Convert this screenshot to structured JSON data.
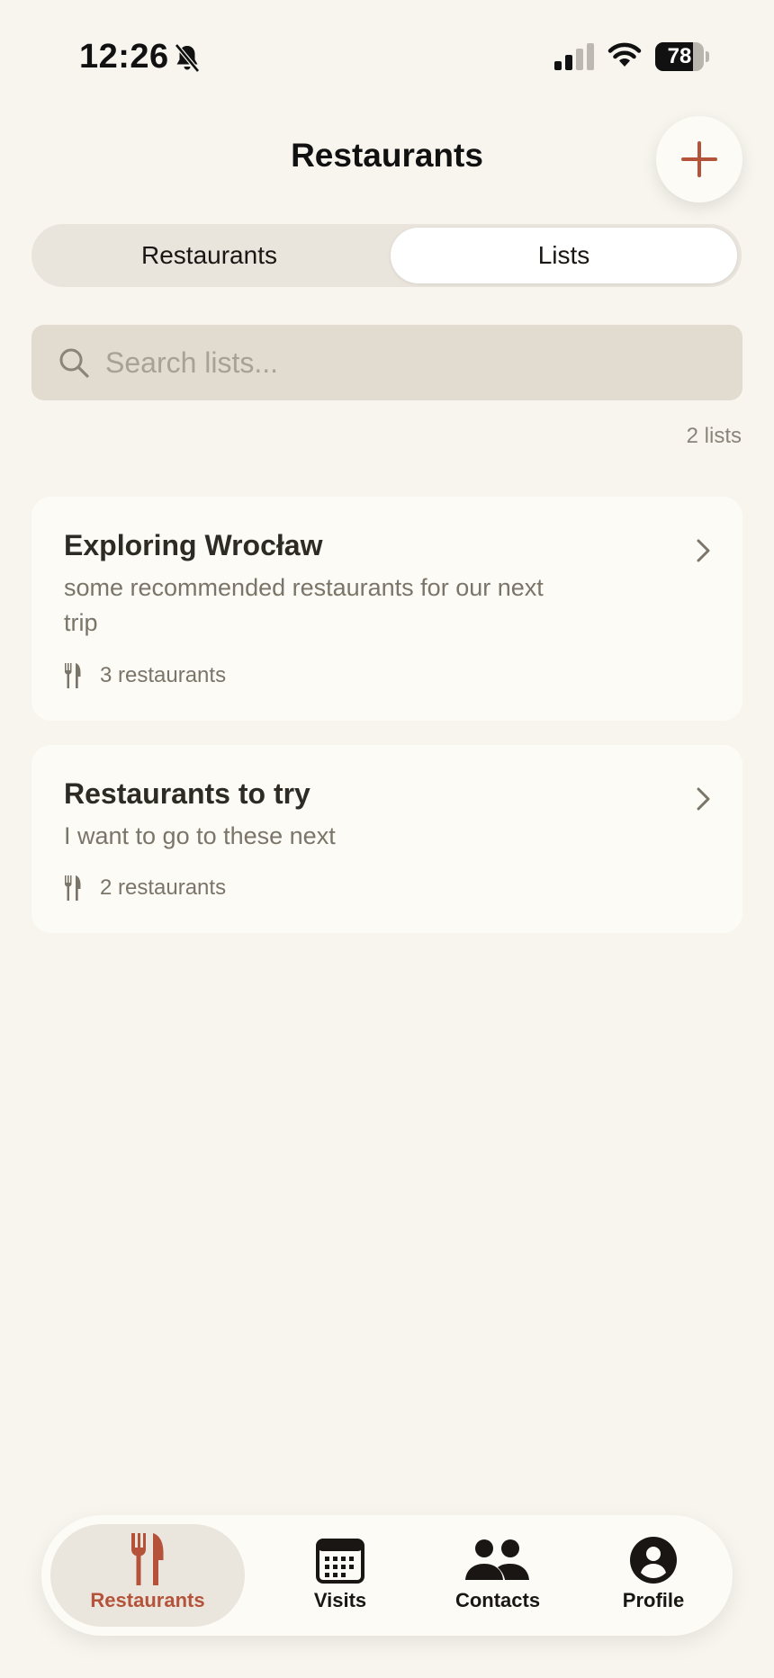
{
  "status_bar": {
    "time": "12:26",
    "battery": "78",
    "battery_level": 0.78
  },
  "header": {
    "title": "Restaurants",
    "add_icon": "plus-icon"
  },
  "segmented": {
    "options": [
      "Restaurants",
      "Lists"
    ],
    "selected": "Lists"
  },
  "search": {
    "placeholder": "Search lists...",
    "value": ""
  },
  "list_count": "2 lists",
  "lists": [
    {
      "title": "Exploring Wrocław",
      "description": "some recommended restaurants for our next trip",
      "count": "3 restaurants"
    },
    {
      "title": "Restaurants to try",
      "description": "I want to go to these next",
      "count": "2 restaurants"
    }
  ],
  "tabs": [
    {
      "label": "Restaurants",
      "icon": "fork-knife-icon",
      "active": true
    },
    {
      "label": "Visits",
      "icon": "calendar-icon",
      "active": false
    },
    {
      "label": "Contacts",
      "icon": "people-icon",
      "active": false
    },
    {
      "label": "Profile",
      "icon": "person-circle-icon",
      "active": false
    }
  ],
  "colors": {
    "background": "#f8f5ef",
    "accent": "#b4533a",
    "card": "#fdfbf6",
    "search_bg": "#e2dbcf"
  }
}
